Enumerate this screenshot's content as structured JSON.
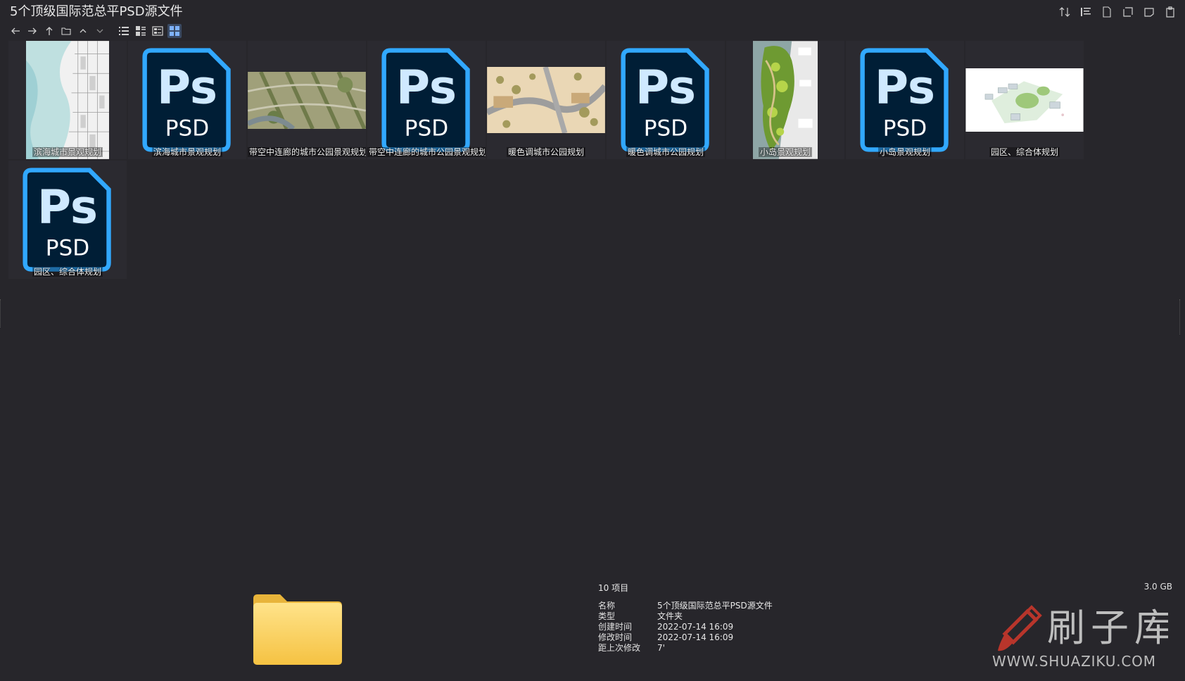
{
  "window": {
    "title": "5个顶级国际范总平PSD源文件"
  },
  "toolbar": {
    "nav_icons": [
      "back-arrow-icon",
      "forward-arrow-icon",
      "up-arrow-icon",
      "folder-icon",
      "chevron-up-icon",
      "chevron-down-icon"
    ],
    "view_icons": [
      "list-view-icon",
      "details-view-icon",
      "tiles-view-icon",
      "thumbnails-view-icon"
    ],
    "right_icons": [
      "sort-icon",
      "group-icon",
      "new-file-icon",
      "expand-icon",
      "panel-icon",
      "clipboard-icon"
    ]
  },
  "files": [
    {
      "label": "滨海城市景观规划",
      "kind": "jpg",
      "thumb": "coastal-map"
    },
    {
      "label": "滨海城市景观规划",
      "kind": "psd",
      "badge_top": "Ps",
      "badge_bottom": "PSD"
    },
    {
      "label": "带空中连廊的城市公园景观规划",
      "kind": "jpg",
      "thumb": "park-aerial"
    },
    {
      "label": "带空中连廊的城市公园景观规划",
      "kind": "psd",
      "badge_top": "Ps",
      "badge_bottom": "PSD"
    },
    {
      "label": "暖色调城市公园规划",
      "kind": "jpg",
      "thumb": "warm-park"
    },
    {
      "label": "暖色调城市公园规划",
      "kind": "psd",
      "badge_top": "Ps",
      "badge_bottom": "PSD"
    },
    {
      "label": "小岛景观规划",
      "kind": "jpg",
      "thumb": "island"
    },
    {
      "label": "小岛景观规划",
      "kind": "psd",
      "badge_top": "Ps",
      "badge_bottom": "PSD"
    },
    {
      "label": "园区、综合体规划",
      "kind": "jpg",
      "thumb": "campus"
    },
    {
      "label": "园区、综合体规划",
      "kind": "psd",
      "badge_top": "Ps",
      "badge_bottom": "PSD"
    }
  ],
  "details": {
    "count": "10 项目",
    "size": "3.0 GB",
    "rows": [
      {
        "key": "名称",
        "value": "5个顶级国际范总平PSD源文件"
      },
      {
        "key": "类型",
        "value": "文件夹"
      },
      {
        "key": "创建时间",
        "value": "2022-07-14  16:09"
      },
      {
        "key": "修改时间",
        "value": "2022-07-14  16:09"
      },
      {
        "key": "距上次修改",
        "value": "7'"
      }
    ]
  },
  "watermark": {
    "cn": "刷子库",
    "url": "WWW.SHUAZIKU.COM",
    "color": "#c0392b"
  },
  "colors": {
    "background": "#27262b",
    "psd_blue": "#31a8ff",
    "psd_dark": "#001e36"
  }
}
